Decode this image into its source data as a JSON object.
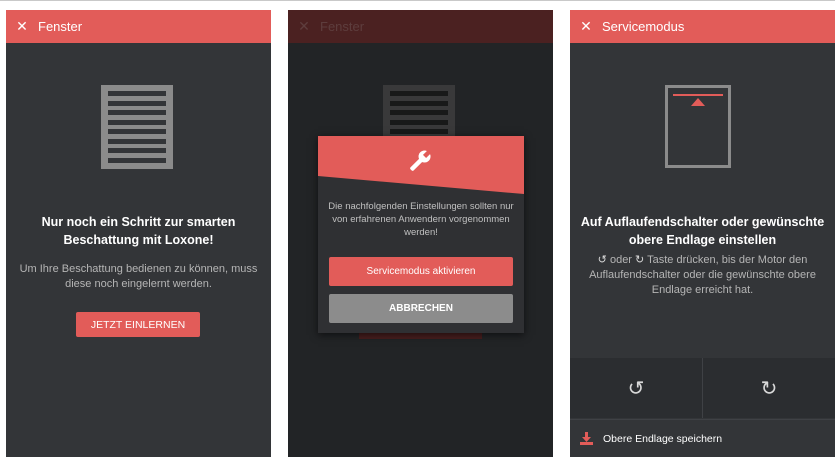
{
  "colors": {
    "accent": "#e25c59",
    "background": "#333538",
    "muted_text": "#b5b5b5",
    "cancel_button": "#8c8c8c"
  },
  "screen1": {
    "close_icon": "close-icon",
    "title": "Fenster",
    "heading": "Nur noch ein Schritt zur smarten Beschattung mit Loxone!",
    "body": "Um Ihre Beschattung bedienen zu können, muss diese noch eingelernt werden.",
    "button": "JETZT EINLERNEN"
  },
  "screen2": {
    "close_icon": "close-icon",
    "title": "Fenster",
    "dialog": {
      "icon": "wrench-icon",
      "message": "Die nachfolgenden Einstellungen sollten nur von erfahrenen Anwendern vorgenommen werden!",
      "primary_button": "Servicemodus aktivieren",
      "secondary_button": "ABBRECHEN"
    }
  },
  "screen3": {
    "close_icon": "close-icon",
    "title": "Servicemodus",
    "heading": "Auf Auflaufendschalter oder gewünschte obere Endlage einstellen",
    "instruction_or": "oder",
    "instruction_rest": "Taste drücken, bis der Motor den Auflaufendschalter oder die gewünschte obere Endlage erreicht hat.",
    "rotate_left_icon": "rotate-ccw-icon",
    "rotate_right_icon": "rotate-cw-icon",
    "save_label": "Obere Endlage speichern",
    "save_icon": "download-icon"
  }
}
